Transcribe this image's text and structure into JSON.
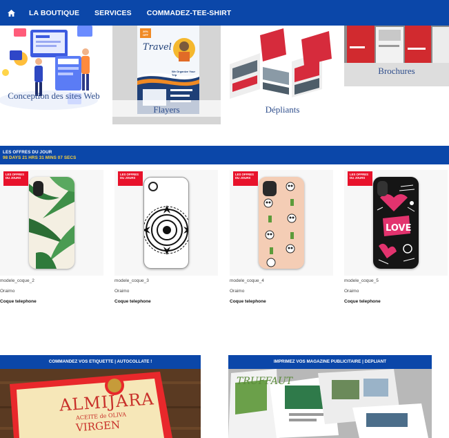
{
  "nav": {
    "home_icon": "home-icon",
    "items": [
      "LA BOUTIQUE",
      "SERVICES",
      "COMMADEZ-TEE-SHIRT"
    ]
  },
  "categories": [
    {
      "label": "Conception des sites Web"
    },
    {
      "label": "Flayers"
    },
    {
      "label": "Dépliants"
    },
    {
      "label": "Brochures"
    }
  ],
  "flyer": {
    "title": "Travel",
    "tagline": "We Organize Your Trip",
    "discount": "20% OFF"
  },
  "brochure_logo": "ALMIJARA",
  "label_text": {
    "brand": "ALMIJARA",
    "line1": "ACEITE de OLIVA",
    "line2": "VIRGEN"
  },
  "magazine_text": "TRUFFAUT",
  "deals": {
    "title": "LES OFFRES DU JOUR",
    "countdown": "98 DAYS 21 HRS 31 MINS 07 SECS",
    "badge": "LES OFFRES DU JOURS",
    "products": [
      {
        "name": "modele_coque_2",
        "brand": "Oraimo",
        "category": "Coque telephone",
        "design": "palm leaves"
      },
      {
        "name": "modele_coque_3",
        "brand": "Oraimo",
        "category": "Coque telephone",
        "design": "mandala"
      },
      {
        "name": "modele_coque_4",
        "brand": "Oraimo",
        "category": "Coque telephone",
        "design": "panda cactus"
      },
      {
        "name": "modele_coque_5",
        "brand": "Oraimo",
        "category": "Coque telephone",
        "design": "love doodle"
      }
    ]
  },
  "promos": [
    {
      "title": "COMMANDEZ VOS ETIQUETTE | AUTOCOLLATE !"
    },
    {
      "title": "IMPRIMEZ VOS MAGAZINE PUBLICITAIRE | DEPLIANT"
    }
  ],
  "colors": {
    "nav": "#0b47a9",
    "badge": "#e8122b",
    "countdown": "#ffd43a"
  }
}
